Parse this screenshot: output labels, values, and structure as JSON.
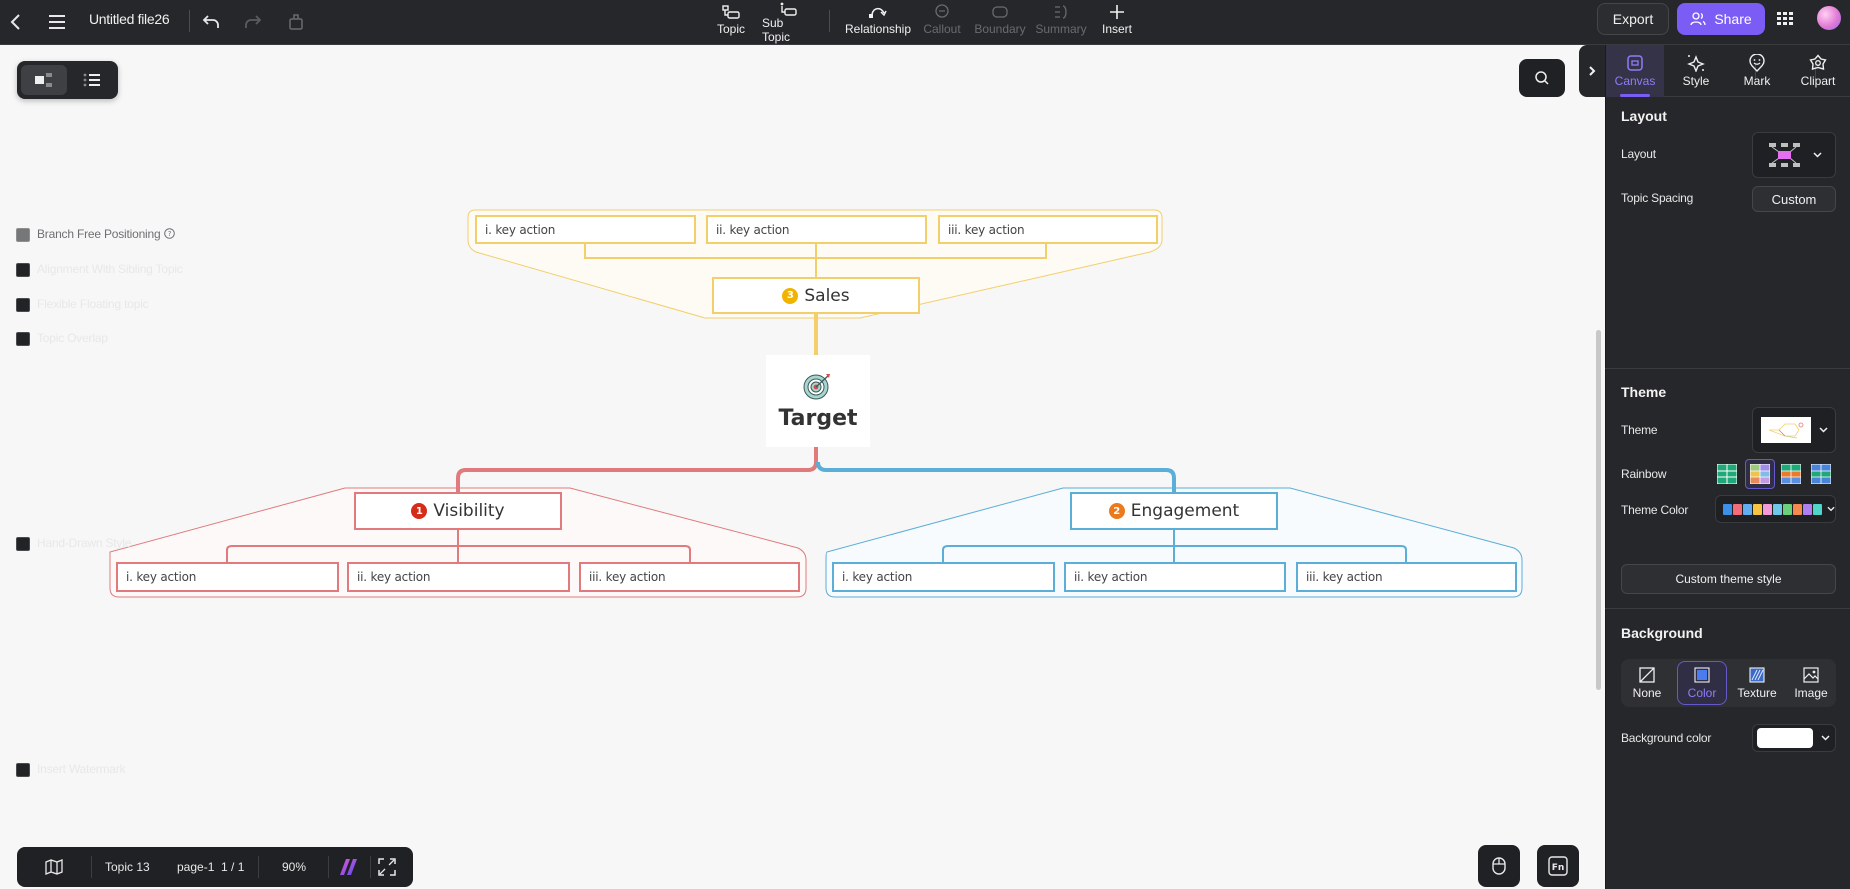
{
  "header": {
    "file_title": "Untitled file26",
    "tools": [
      {
        "label": "Topic",
        "icon": "topic-icon",
        "enabled": true
      },
      {
        "label": "Sub Topic",
        "icon": "subtopic-icon",
        "enabled": true
      },
      {
        "label": "Relationship",
        "icon": "relationship-icon",
        "enabled": true
      },
      {
        "label": "Callout",
        "icon": "callout-icon",
        "enabled": false
      },
      {
        "label": "Boundary",
        "icon": "boundary-icon",
        "enabled": false
      },
      {
        "label": "Summary",
        "icon": "summary-icon",
        "enabled": false
      },
      {
        "label": "Insert",
        "icon": "plus-icon",
        "enabled": true
      }
    ],
    "export_label": "Export",
    "share_label": "Share",
    "accent": "#7b5cf5"
  },
  "mindmap": {
    "central": {
      "title": "Target",
      "icon": "target-icon"
    },
    "branches": [
      {
        "name": "Sales",
        "number": "3",
        "badge_color": "#f0b400",
        "color": "#f2cf6b",
        "children": [
          "i. key action",
          "ii. key action",
          "iii. key action"
        ]
      },
      {
        "name": "Visibility",
        "number": "1",
        "badge_color": "#d62c1a",
        "color": "#e07a7c",
        "children": [
          "i. key action",
          "ii. key action",
          "iii. key action"
        ]
      },
      {
        "name": "Engagement",
        "number": "2",
        "badge_color": "#ea7a1c",
        "color": "#5aaed8",
        "children": [
          "i. key action",
          "ii. key action",
          "iii. key action"
        ]
      }
    ]
  },
  "bottom_bar": {
    "topic_count": "Topic 13",
    "page_label": "page-1",
    "page_index": "1 / 1",
    "zoom": "90%"
  },
  "panel": {
    "tabs": [
      {
        "label": "Canvas",
        "active": true
      },
      {
        "label": "Style",
        "active": false
      },
      {
        "label": "Mark",
        "active": false
      },
      {
        "label": "Clipart",
        "active": false
      }
    ],
    "layout": {
      "section_title": "Layout",
      "layout_label": "Layout",
      "topic_spacing_label": "Topic Spacing",
      "topic_spacing_value": "Custom",
      "options": [
        {
          "label": "Branch Free Positioning",
          "checked": false,
          "disabled": true
        },
        {
          "label": "Alignment With Sibling Topic",
          "checked": false,
          "disabled": false
        },
        {
          "label": "Flexible Floating topic",
          "checked": false,
          "disabled": false
        },
        {
          "label": "Topic Overlap",
          "checked": false,
          "disabled": false
        }
      ]
    },
    "theme": {
      "section_title": "Theme",
      "theme_label": "Theme",
      "rainbow_label": "Rainbow",
      "rainbow_selected_index": 1,
      "theme_color_label": "Theme Color",
      "theme_colors": [
        "#3d8fe8",
        "#f26d7a",
        "#63aef0",
        "#f6c343",
        "#f39ad8",
        "#6ec8e8",
        "#6ad07a",
        "#f58a4f",
        "#b07ff0",
        "#4fd6c8"
      ],
      "hand_drawn_label": "Hand-Drawn Style",
      "custom_button": "Custom theme style"
    },
    "background": {
      "section_title": "Background",
      "options": [
        {
          "label": "None",
          "active": false
        },
        {
          "label": "Color",
          "active": true
        },
        {
          "label": "Texture",
          "active": false
        },
        {
          "label": "Image",
          "active": false
        }
      ],
      "bg_color_label": "Background color",
      "bg_color_value": "#ffffff",
      "watermark_label": "Insert Watermark"
    }
  }
}
